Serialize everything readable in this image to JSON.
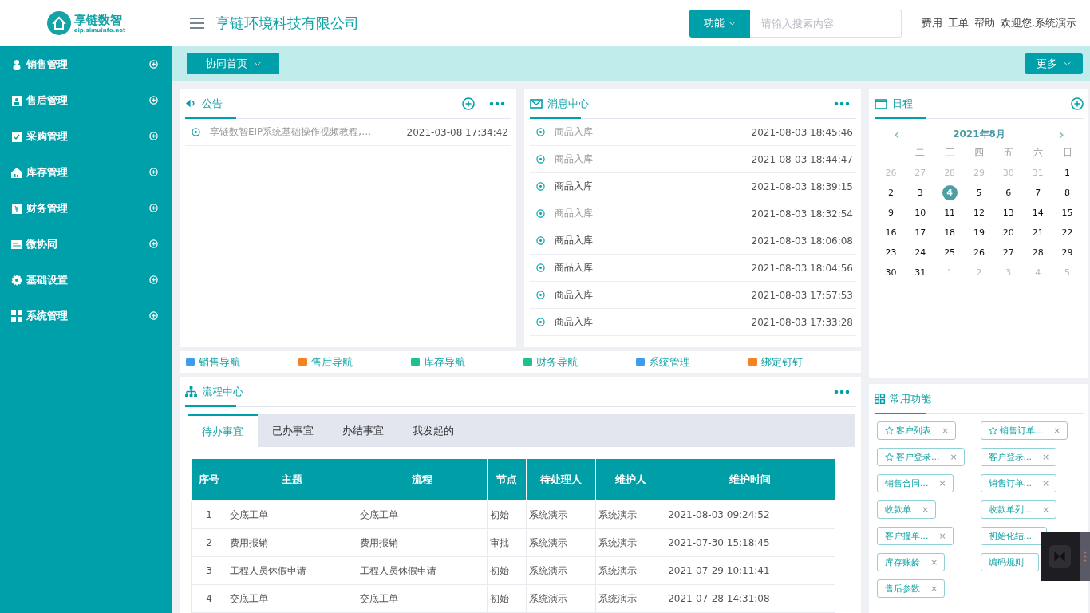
{
  "logo": {
    "name": "享链数智",
    "url": "eip.simuinfo.net"
  },
  "header": {
    "company": "享链环境科技有限公司",
    "function_button": "功能",
    "search": {
      "placeholder": "请输入搜索内容"
    },
    "links": [
      "费用",
      "工单",
      "帮助"
    ],
    "welcome": "欢迎您,系统演示"
  },
  "sidebar": {
    "items": [
      {
        "label": "销售管理"
      },
      {
        "label": "售后管理"
      },
      {
        "label": "采购管理"
      },
      {
        "label": "库存管理"
      },
      {
        "label": "财务管理"
      },
      {
        "label": "微协同"
      },
      {
        "label": "基础设置"
      },
      {
        "label": "系统管理"
      }
    ]
  },
  "toolbar": {
    "home_tab": "协同首页",
    "more_button": "更多"
  },
  "notice": {
    "title": "公告",
    "items": [
      {
        "text": "享链数智EIP系统基础操作视频教程,…",
        "time": "2021-03-08 17:34:42"
      }
    ]
  },
  "messages": {
    "title": "消息中心",
    "items": [
      {
        "text": "商品入库",
        "time": "2021-08-03 18:45:46",
        "read": true
      },
      {
        "text": "商品入库",
        "time": "2021-08-03 18:44:47",
        "read": true
      },
      {
        "text": "商品入库",
        "time": "2021-08-03 18:39:15",
        "read": false
      },
      {
        "text": "商品入库",
        "time": "2021-08-03 18:32:54",
        "read": true
      },
      {
        "text": "商品入库",
        "time": "2021-08-03 18:06:08",
        "read": false
      },
      {
        "text": "商品入库",
        "time": "2021-08-03 18:04:56",
        "read": false
      },
      {
        "text": "商品入库",
        "time": "2021-08-03 17:57:53",
        "read": false
      },
      {
        "text": "商品入库",
        "time": "2021-08-03 17:33:28",
        "read": false
      }
    ]
  },
  "calendar": {
    "title": "日程",
    "prev": "‹",
    "month": "2021年8月",
    "next": "›",
    "weekdays": [
      "一",
      "二",
      "三",
      "四",
      "五",
      "六",
      "日"
    ],
    "days": [
      {
        "d": "26",
        "muted": true,
        "selected": false
      },
      {
        "d": "27",
        "muted": true,
        "selected": false
      },
      {
        "d": "28",
        "muted": true,
        "selected": false
      },
      {
        "d": "29",
        "muted": true,
        "selected": false
      },
      {
        "d": "30",
        "muted": true,
        "selected": false
      },
      {
        "d": "31",
        "muted": true,
        "selected": false
      },
      {
        "d": "1",
        "muted": false,
        "selected": false
      },
      {
        "d": "2",
        "muted": false,
        "selected": false
      },
      {
        "d": "3",
        "muted": false,
        "selected": false
      },
      {
        "d": "4",
        "muted": false,
        "selected": true
      },
      {
        "d": "5",
        "muted": false,
        "selected": false
      },
      {
        "d": "6",
        "muted": false,
        "selected": false
      },
      {
        "d": "7",
        "muted": false,
        "selected": false
      },
      {
        "d": "8",
        "muted": false,
        "selected": false
      },
      {
        "d": "9",
        "muted": false,
        "selected": false
      },
      {
        "d": "10",
        "muted": false,
        "selected": false
      },
      {
        "d": "11",
        "muted": false,
        "selected": false
      },
      {
        "d": "12",
        "muted": false,
        "selected": false
      },
      {
        "d": "13",
        "muted": false,
        "selected": false
      },
      {
        "d": "14",
        "muted": false,
        "selected": false
      },
      {
        "d": "15",
        "muted": false,
        "selected": false
      },
      {
        "d": "16",
        "muted": false,
        "selected": false
      },
      {
        "d": "17",
        "muted": false,
        "selected": false
      },
      {
        "d": "18",
        "muted": false,
        "selected": false
      },
      {
        "d": "19",
        "muted": false,
        "selected": false
      },
      {
        "d": "20",
        "muted": false,
        "selected": false
      },
      {
        "d": "21",
        "muted": false,
        "selected": false
      },
      {
        "d": "22",
        "muted": false,
        "selected": false
      },
      {
        "d": "23",
        "muted": false,
        "selected": false
      },
      {
        "d": "24",
        "muted": false,
        "selected": false
      },
      {
        "d": "25",
        "muted": false,
        "selected": false
      },
      {
        "d": "26",
        "muted": false,
        "selected": false
      },
      {
        "d": "27",
        "muted": false,
        "selected": false
      },
      {
        "d": "28",
        "muted": false,
        "selected": false
      },
      {
        "d": "29",
        "muted": false,
        "selected": false
      },
      {
        "d": "30",
        "muted": false,
        "selected": false
      },
      {
        "d": "31",
        "muted": false,
        "selected": false
      },
      {
        "d": "1",
        "muted": true,
        "selected": false
      },
      {
        "d": "2",
        "muted": true,
        "selected": false
      },
      {
        "d": "3",
        "muted": true,
        "selected": false
      },
      {
        "d": "4",
        "muted": true,
        "selected": false
      },
      {
        "d": "5",
        "muted": true,
        "selected": false
      }
    ]
  },
  "nav_links": [
    {
      "label": "销售导航",
      "color": "#3d9cf0"
    },
    {
      "label": "售后导航",
      "color": "#f58220"
    },
    {
      "label": "库存导航",
      "color": "#1ec08e"
    },
    {
      "label": "财务导航",
      "color": "#1ec08e"
    },
    {
      "label": "系统管理",
      "color": "#3d9cf0"
    },
    {
      "label": "绑定钉钉",
      "color": "#f58220"
    }
  ],
  "workflow": {
    "title": "流程中心",
    "tabs": [
      {
        "label": "待办事宜",
        "selected": true
      },
      {
        "label": "已办事宜",
        "selected": false
      },
      {
        "label": "办结事宜",
        "selected": false
      },
      {
        "label": "我发起的",
        "selected": false
      }
    ],
    "table": {
      "columns": [
        "序号",
        "主题",
        "流程",
        "节点",
        "待处理人",
        "维护人",
        "维护时间"
      ],
      "rows": [
        [
          "1",
          "交底工单",
          "交底工单",
          "初始",
          "系统演示",
          "系统演示",
          "2021-08-03 09:24:52"
        ],
        [
          "2",
          "费用报销",
          "费用报销",
          "审批",
          "系统演示",
          "系统演示",
          "2021-07-30 15:18:45"
        ],
        [
          "3",
          "工程人员休假申请",
          "工程人员休假申请",
          "初始",
          "系统演示",
          "系统演示",
          "2021-07-29 10:11:41"
        ],
        [
          "4",
          "交底工单",
          "交底工单",
          "初始",
          "系统演示",
          "系统演示",
          "2021-07-28 14:31:08"
        ]
      ]
    }
  },
  "shortcuts": {
    "title": "常用功能",
    "tags": [
      {
        "label": "客户列表",
        "starred": true,
        "close": "×"
      },
      {
        "label": "销售订单...",
        "starred": true,
        "close": "×"
      },
      {
        "label": "客户登录...",
        "starred": true,
        "close": "×"
      },
      {
        "label": "客户登录...",
        "starred": false,
        "close": "×"
      },
      {
        "label": "销售合同...",
        "starred": false,
        "close": "×"
      },
      {
        "label": "销售订单...",
        "starred": false,
        "close": "×"
      },
      {
        "label": "收款单",
        "starred": false,
        "close": "×"
      },
      {
        "label": "收款单列...",
        "starred": false,
        "close": "×"
      },
      {
        "label": "客户撞单...",
        "starred": false,
        "close": "×"
      },
      {
        "label": "初始化结...",
        "starred": false
      },
      {
        "label": "库存账龄",
        "starred": false,
        "close": "×"
      },
      {
        "label": "编码规则",
        "starred": false
      },
      {
        "label": "售后参数",
        "starred": false,
        "close": "×"
      }
    ]
  }
}
